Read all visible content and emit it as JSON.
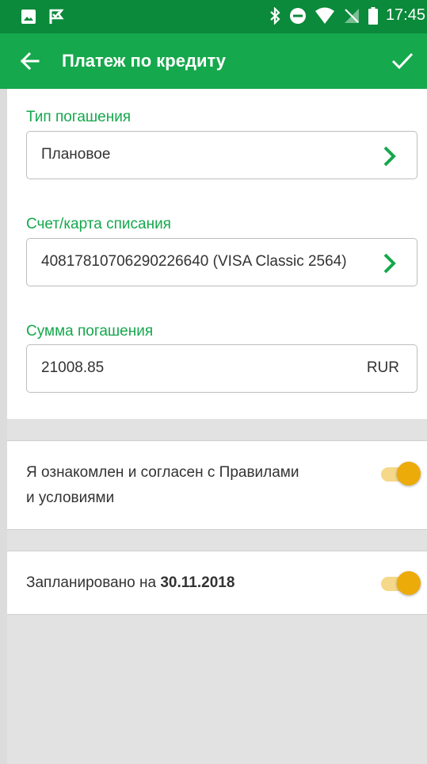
{
  "status_bar": {
    "time": "17:45",
    "icons": [
      "image-icon",
      "check-flag-icon",
      "bluetooth-icon",
      "do-not-disturb-icon",
      "wifi-icon",
      "no-sim-icon",
      "battery-icon"
    ]
  },
  "app_bar": {
    "title": "Платеж по кредиту",
    "back_icon": "arrow-left-icon",
    "confirm_icon": "check-icon"
  },
  "form": {
    "repayment_type": {
      "label": "Тип погашения",
      "value": "Плановое"
    },
    "debit_account": {
      "label": "Счет/карта списания",
      "value": "40817810706290226640 (VISA Classic 2564)"
    },
    "repayment_amount": {
      "label": "Сумма погашения",
      "value": "21008.85",
      "currency": "RUR"
    }
  },
  "agreement": {
    "line1": "Я ознакомлен и согласен с Правилами",
    "line2": "и условиями",
    "enabled": true
  },
  "scheduled": {
    "prefix": "Запланировано на",
    "date": "30.11.2018",
    "enabled": true
  },
  "colors": {
    "status_bar": "#0a8a3a",
    "app_bar": "#15a84c",
    "accent": "#15a84c",
    "toggle_thumb": "#edab0a",
    "toggle_track": "#f5d88a",
    "background": "#e2e2e2"
  }
}
